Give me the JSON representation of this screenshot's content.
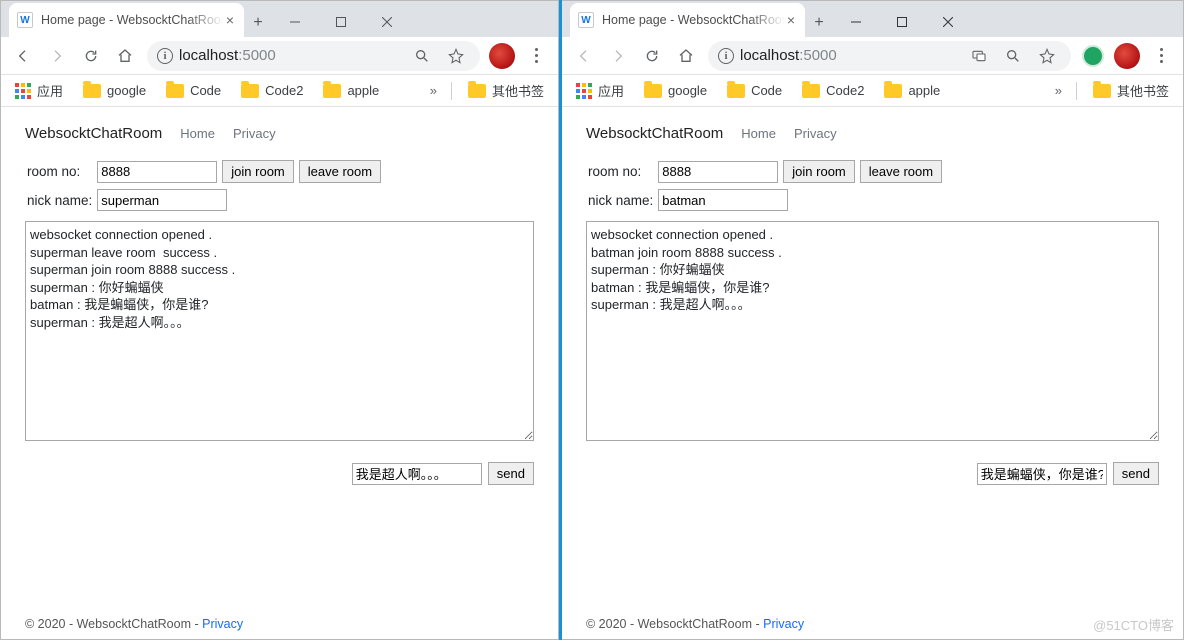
{
  "watermark": "@51CTO博客",
  "browser": {
    "tab_title": "Home page - WebsocktChatRoom",
    "url_host": "localhost",
    "url_path": ":5000",
    "apps_label": "应用",
    "bookmarks": [
      "google",
      "Code",
      "Code2",
      "apple"
    ],
    "overflow_label": "»",
    "other_bookmarks": "其他书签"
  },
  "page": {
    "brand": "WebsocktChatRoom",
    "nav_home": "Home",
    "nav_privacy": "Privacy",
    "label_room": "room no:",
    "label_nick": "nick name:",
    "btn_join": "join room",
    "btn_leave": "leave room",
    "btn_send": "send",
    "footer_text": "© 2020 - WebsocktChatRoom - ",
    "footer_link": "Privacy"
  },
  "left": {
    "room": "8888",
    "nick": "superman",
    "log": "websocket connection opened .\nsuperman leave room  success .\nsuperman join room 8888 success .\nsuperman : 你好蝙蝠侠\nbatman : 我是蝙蝠侠，你是谁?\nsuperman : 我是超人啊。。。",
    "msg": "我是超人啊。。。"
  },
  "right": {
    "room": "8888",
    "nick": "batman",
    "log": "websocket connection opened .\nbatman join room 8888 success .\nsuperman : 你好蝙蝠侠\nbatman : 我是蝙蝠侠，你是谁?\nsuperman : 我是超人啊。。。",
    "msg": "我是蝙蝠侠，你是谁?"
  }
}
